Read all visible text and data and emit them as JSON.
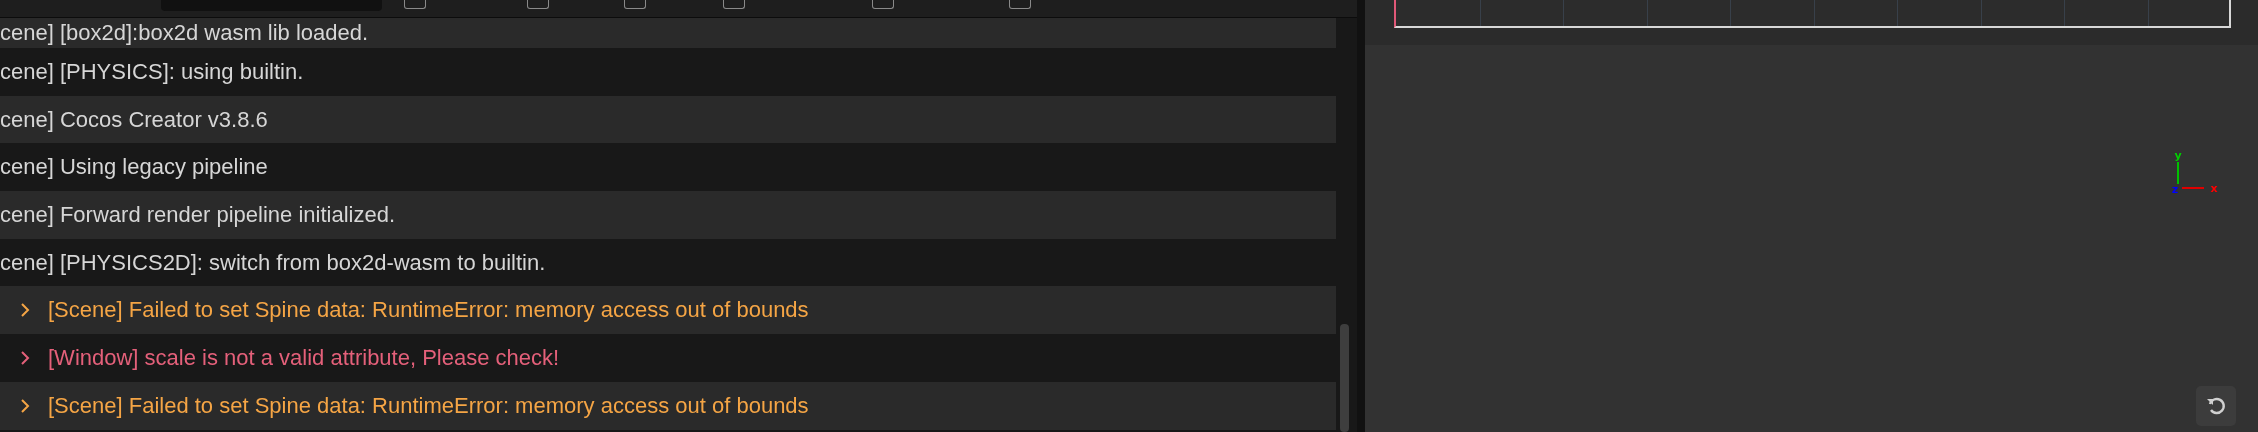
{
  "console": {
    "toolbar": {
      "search": {
        "kind": "field"
      },
      "checkboxes": [
        {
          "checked": false
        },
        {
          "checked": false
        },
        {
          "checked": false
        },
        {
          "checked": false
        },
        {
          "checked": false
        },
        {
          "checked": false
        }
      ]
    },
    "logs": [
      {
        "kind": "log",
        "text": "cene] [box2d]:box2d wasm lib loaded."
      },
      {
        "kind": "log",
        "text": "cene] [PHYSICS]: using builtin."
      },
      {
        "kind": "log",
        "text": "cene] Cocos Creator v3.8.6"
      },
      {
        "kind": "log",
        "text": "cene] Using legacy pipeline"
      },
      {
        "kind": "log",
        "text": "cene] Forward render pipeline initialized."
      },
      {
        "kind": "log",
        "text": "cene] [PHYSICS2D]: switch from box2d-wasm to builtin."
      },
      {
        "kind": "warn",
        "text": "[Scene] Failed to set Spine data: RuntimeError: memory access out of bounds"
      },
      {
        "kind": "error",
        "text": "[Window] scale is not a valid attribute, Please check!"
      },
      {
        "kind": "warn",
        "text": "[Scene] Failed to set Spine data: RuntimeError: memory access out of bounds"
      }
    ]
  },
  "scene": {
    "gizmo": {
      "x": "x",
      "y": "y",
      "z": "z"
    }
  }
}
